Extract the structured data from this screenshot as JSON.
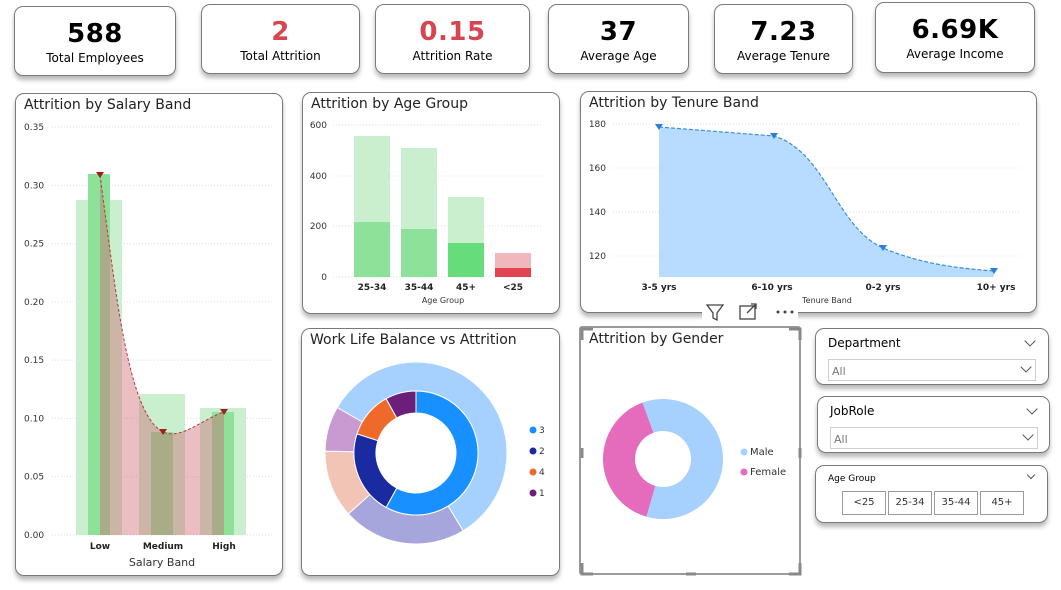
{
  "kpis": [
    {
      "value": "588",
      "label": "Total Employees"
    },
    {
      "value": "2",
      "label": "Total Attrition"
    },
    {
      "value": "0.15",
      "label": "Attrition Rate"
    },
    {
      "value": "37",
      "label": "Average Age"
    },
    {
      "value": "7.23",
      "label": "Average Tenure"
    },
    {
      "value": "6.69K",
      "label": "Average Income"
    }
  ],
  "colors": {
    "accent_red": "#d64550",
    "green_light": "#c9efcf",
    "green": "#8de199",
    "blue_area": "#b8dcff",
    "blue_line": "#3a8ee6"
  },
  "salary_chart": {
    "title": "Attrition by Salary Band",
    "xlabel": "Salary Band",
    "yticks": [
      "0.35",
      "0.30",
      "0.25",
      "0.20",
      "0.15",
      "0.10",
      "0.05",
      "0.00"
    ],
    "categories": [
      "Low",
      "Medium",
      "High"
    ]
  },
  "age_chart": {
    "title": "Attrition by Age Group",
    "xlabel": "Age Group",
    "yticks": [
      "600",
      "400",
      "200",
      "0"
    ],
    "categories": [
      "25-34",
      "35-44",
      "45+",
      "<25"
    ]
  },
  "tenure_chart": {
    "title": "Attrition by Tenure Band",
    "xlabel": "Tenure Band",
    "yticks": [
      "180",
      "160",
      "140",
      "120"
    ],
    "categories": [
      "3-5 yrs",
      "6-10 yrs",
      "0-2 yrs",
      "10+ yrs"
    ]
  },
  "wlb_chart": {
    "title": "Work Life Balance vs Attrition",
    "legend": [
      "3",
      "2",
      "4",
      "1"
    ]
  },
  "gender_chart": {
    "title": "Attrition by Gender",
    "legend": [
      "Male",
      "Female"
    ]
  },
  "slicers": {
    "department": {
      "title": "Department",
      "value": "All"
    },
    "jobrole": {
      "title": "JobRole",
      "value": "All"
    },
    "age_group": {
      "title": "Age Group",
      "options": [
        "<25",
        "25-34",
        "35-44",
        "45+"
      ]
    }
  },
  "chart_data": [
    {
      "type": "bar",
      "title": "Attrition by Salary Band",
      "xlabel": "Salary Band",
      "categories": [
        "Low",
        "Medium",
        "High"
      ],
      "ylim": [
        0,
        0.35
      ],
      "grid": true,
      "series": [
        {
          "type": "bar",
          "values": [
            0.285,
            0.12,
            0.108
          ]
        },
        {
          "type": "line",
          "values": [
            0.307,
            0.087,
            0.105
          ]
        }
      ]
    },
    {
      "type": "bar",
      "title": "Attrition by Age Group",
      "xlabel": "Age Group",
      "categories": [
        "25-34",
        "35-44",
        "45+",
        "<25"
      ],
      "ylim": [
        0,
        600
      ],
      "grid": true,
      "series": [
        {
          "values": [
            555,
            505,
            315,
            95
          ]
        },
        {
          "values": [
            215,
            190,
            135,
            35
          ]
        }
      ]
    },
    {
      "type": "area",
      "title": "Attrition by Tenure Band",
      "xlabel": "Tenure Band",
      "categories": [
        "3-5 yrs",
        "6-10 yrs",
        "0-2 yrs",
        "10+ yrs"
      ],
      "ylim": [
        110,
        180
      ],
      "grid": true,
      "series": [
        {
          "values": [
            178,
            174,
            123,
            113
          ]
        }
      ]
    },
    {
      "type": "pie",
      "title": "Work Life Balance vs Attrition",
      "series": [
        {
          "ring": "inner",
          "labels": [
            "3",
            "2",
            "4",
            "1"
          ],
          "values": [
            58,
            22,
            12,
            8
          ]
        },
        {
          "ring": "outer",
          "labels": [
            "3",
            "2",
            "4",
            "1"
          ],
          "values": [
            58,
            22,
            12,
            8
          ]
        }
      ]
    },
    {
      "type": "pie",
      "title": "Attrition by Gender",
      "series": [
        {
          "labels": [
            "Male",
            "Female"
          ],
          "values": [
            60,
            40
          ]
        }
      ]
    }
  ]
}
